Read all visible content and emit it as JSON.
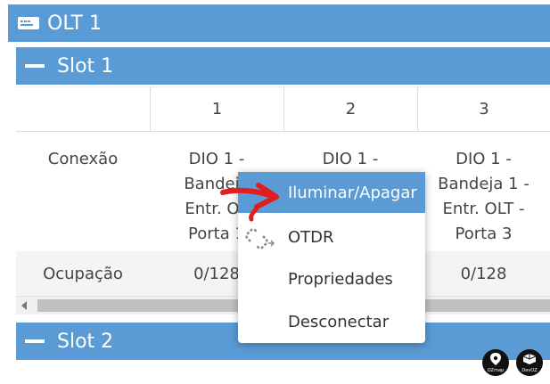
{
  "olt": {
    "title": "OLT 1"
  },
  "slots": [
    {
      "title": "Slot 1"
    },
    {
      "title": "Slot 2"
    }
  ],
  "table": {
    "columns": [
      "",
      "1",
      "2",
      "3"
    ],
    "rows": [
      {
        "label": "Conexão",
        "cells": [
          "DIO 1 - Bandeja 1 - Entr. OLT - Porta 1",
          "DIO 1 -",
          "DIO 1 - Bandeja 1 - Entr. OLT - Porta 3"
        ]
      },
      {
        "label": "Ocupação",
        "cells": [
          "0/128",
          "",
          "0/128"
        ]
      }
    ],
    "conn_lines": {
      "c1": [
        "DIO 1 -",
        "Bandeja",
        "Entr. OL",
        "Porta 1"
      ],
      "c2": [
        "DIO 1 -"
      ],
      "c3": [
        "DIO 1 -",
        "Bandeja 1 -",
        "Entr. OLT -",
        "Porta 3"
      ]
    }
  },
  "context_menu": {
    "items": [
      {
        "label": "Iluminar/Apagar",
        "active": true,
        "icon": "none"
      },
      {
        "label": "OTDR",
        "active": false,
        "icon": "broken-link-icon"
      },
      {
        "label": "Propriedades",
        "active": false,
        "icon": "none"
      },
      {
        "label": "Desconectar",
        "active": false,
        "icon": "none"
      }
    ]
  },
  "colors": {
    "header_blue": "#5b9bd5",
    "annotation_red": "#e11d1d"
  },
  "footer": {
    "brand1": "OZmap",
    "brand2": "DevOZ"
  }
}
